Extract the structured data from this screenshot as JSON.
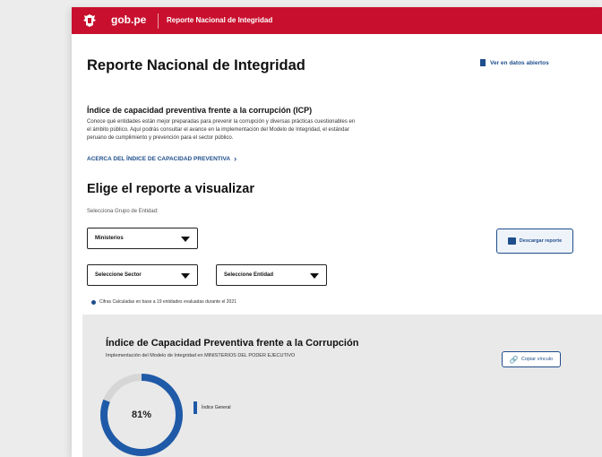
{
  "header": {
    "brand": "gob.pe",
    "site_title": "Reporte Nacional de Integridad"
  },
  "page": {
    "title": "Reporte Nacional de Integridad",
    "open_data_link": "Ver en datos abiertos"
  },
  "icp": {
    "title": "Índice de capacidad preventiva frente a la corrupción (ICP)",
    "description": "Conoce qué entidades están mejor preparadas para prevenir la corrupción y diversas prácticas cuestionables en el ámbito público. Aquí podrás consultar el avance en la implementación del Modelo de Integridad, el estándar peruano de cumplimiento y prevención para el sector público.",
    "about_link": "ACERCA DEL ÍNDICE DE CAPACIDAD PREVENTIVA"
  },
  "report": {
    "heading": "Elige el reporte a visualizar",
    "group_label": "Selecciona Grupo de Entidad:",
    "group_select": "Ministerios",
    "sector_select": "Seleccione Sector",
    "entity_select": "Seleccione Entidad",
    "download_button": "Descargar reporte",
    "info_note": "Cifras Calculadas en base a 19 entidades evaluadas durante el 2021"
  },
  "summary": {
    "title": "Índice de Capacidad Preventiva frente a la Corrupción",
    "subtitle": "Implementación del Modelo de Integridad en MINISTERIOS DEL PODER EJECUTIVO",
    "copy_link": "Copiar vínculo",
    "index_value": 0.81,
    "index_label": "81%",
    "legend_label": "Índice General",
    "ring_color": "#1f5aa8",
    "ring_track_color": "#d6d6d6"
  },
  "colors": {
    "brand_red": "#c8102e",
    "link_blue": "#1f4e8c"
  }
}
